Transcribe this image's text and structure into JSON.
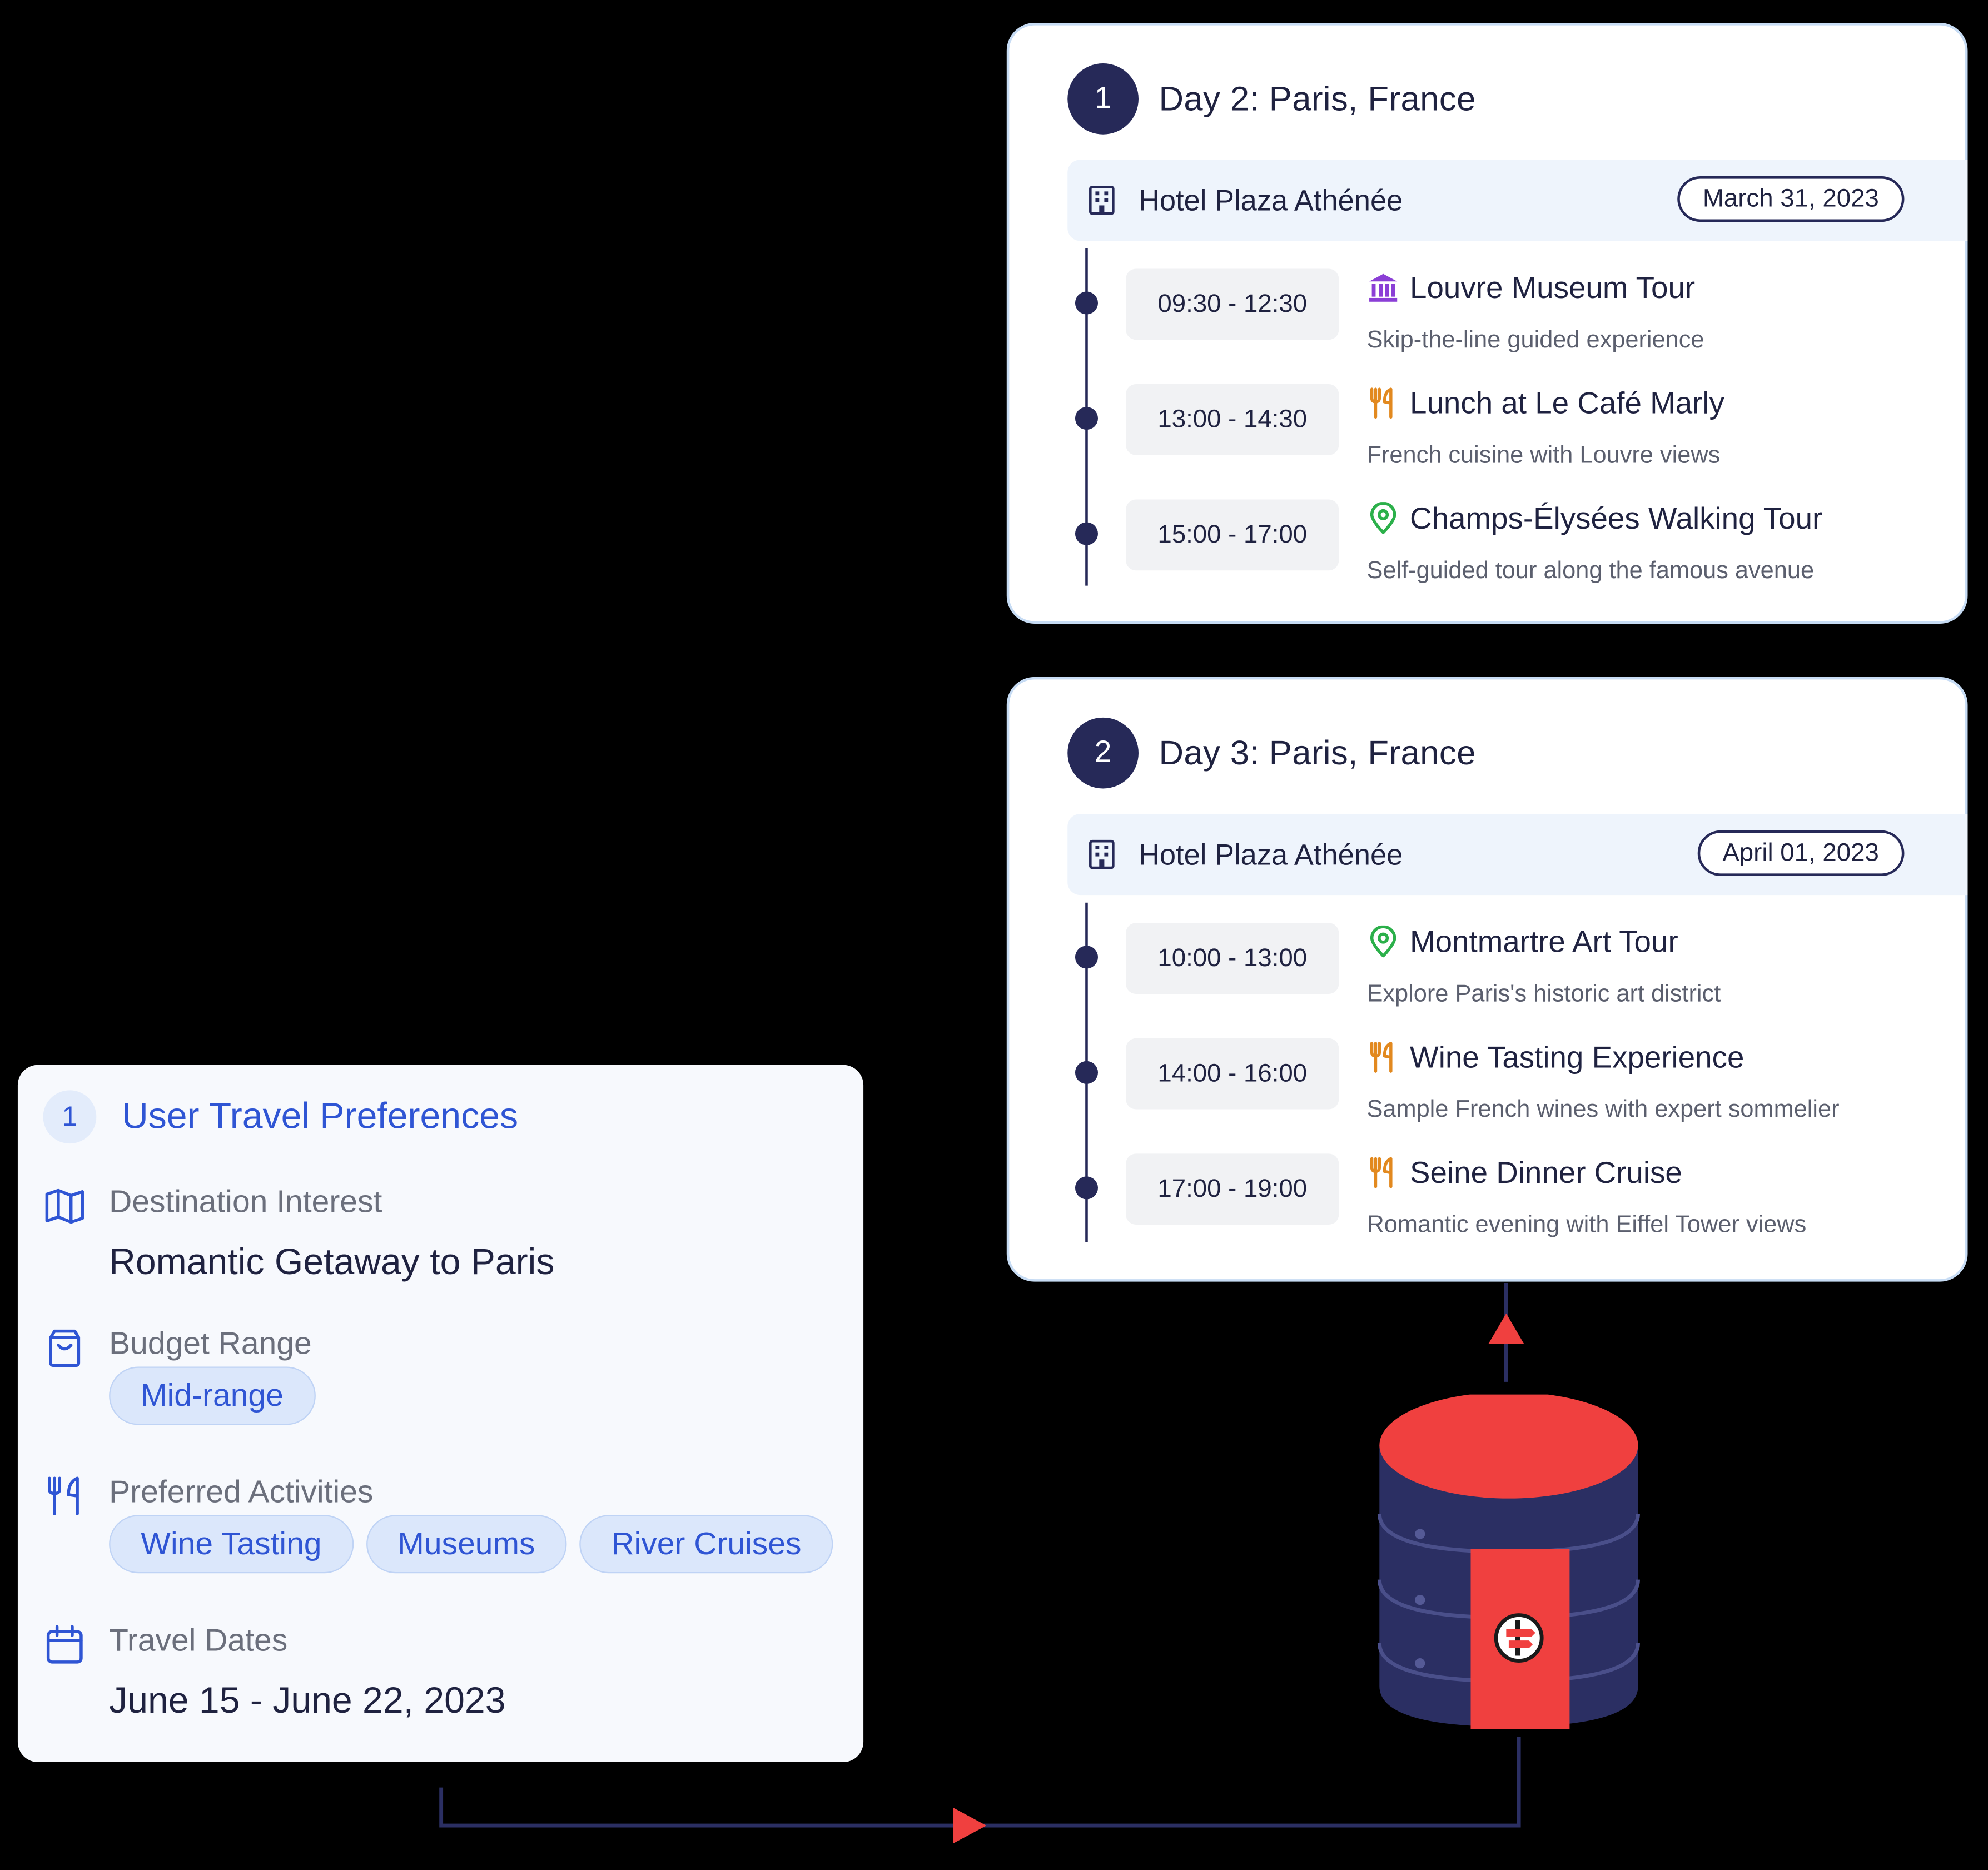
{
  "colors": {
    "navy": "#262958",
    "accent_blue": "#2f55d4",
    "card_border": "#c7dcf4",
    "hotel_bar": "#eef4fc",
    "tag_bg": "#dbe7fb",
    "db_red": "#f0403f",
    "museum_icon": "#8b3fd6",
    "food_icon": "#e2891f",
    "pin_icon": "#2bb04a"
  },
  "days": [
    {
      "number": "1",
      "title": "Day 2: Paris, France",
      "hotel": "Hotel Plaza Athénée",
      "date": "March 31, 2023",
      "activities": [
        {
          "time": "09:30 - 12:30",
          "icon": "museum-icon",
          "title": "Louvre Museum Tour",
          "description": "Skip-the-line guided experience"
        },
        {
          "time": "13:00 - 14:30",
          "icon": "fork-knife-icon",
          "title": "Lunch at Le Café Marly",
          "description": "French cuisine with Louvre views"
        },
        {
          "time": "15:00 - 17:00",
          "icon": "map-pin-icon",
          "title": "Champs-Élysées Walking Tour",
          "description": "Self-guided tour along the famous avenue"
        }
      ]
    },
    {
      "number": "2",
      "title": "Day 3: Paris, France",
      "hotel": "Hotel Plaza Athénée",
      "date": "April 01, 2023",
      "activities": [
        {
          "time": "10:00 - 13:00",
          "icon": "map-pin-icon",
          "title": "Montmartre Art Tour",
          "description": "Explore Paris's historic art district"
        },
        {
          "time": "14:00 - 16:00",
          "icon": "fork-knife-icon",
          "title": "Wine Tasting Experience",
          "description": "Sample French wines with expert sommelier"
        },
        {
          "time": "17:00 - 19:00",
          "icon": "fork-knife-icon",
          "title": "Seine Dinner Cruise",
          "description": "Romantic evening with Eiffel Tower views"
        }
      ]
    }
  ],
  "preferences": {
    "number": "1",
    "title": "User Travel Preferences",
    "destination": {
      "icon": "map-icon",
      "label": "Destination Interest",
      "value": "Romantic Getaway to Paris"
    },
    "budget": {
      "icon": "shopping-bag-icon",
      "label": "Budget Range",
      "tags": [
        "Mid-range"
      ]
    },
    "activities": {
      "icon": "fork-knife-icon",
      "label": "Preferred Activities",
      "tags": [
        "Wine Tasting",
        "Museums",
        "River Cruises"
      ]
    },
    "dates": {
      "icon": "calendar-icon",
      "label": "Travel Dates",
      "value": "June 15 - June 22, 2023"
    }
  },
  "database": {
    "icon": "database-icon",
    "logo": "signpost-logo-icon"
  }
}
